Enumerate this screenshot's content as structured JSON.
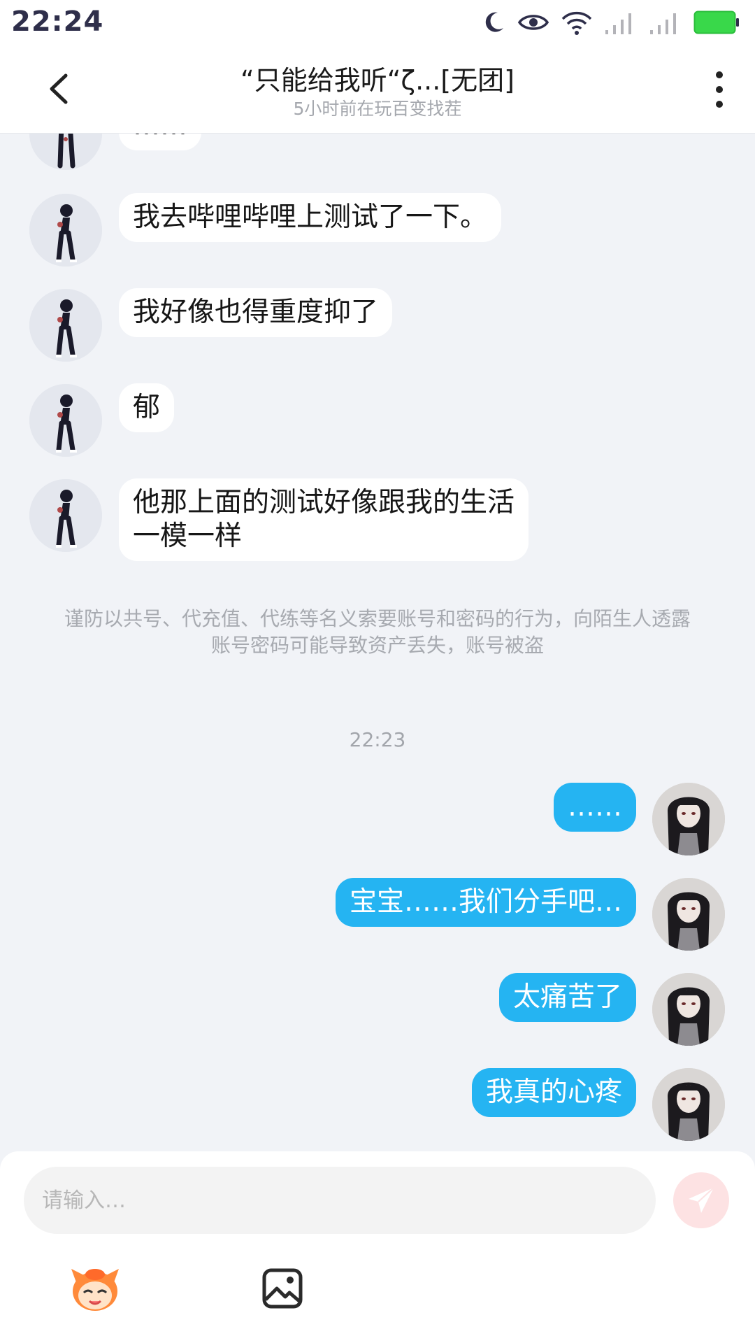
{
  "status": {
    "time": "22:24"
  },
  "header": {
    "title": "“只能给我听“ζ...[无团]",
    "subtitle": "5小时前在玩百变找茬"
  },
  "messages": {
    "partial_top": "……",
    "incoming": [
      "我去哔哩哔哩上测试了一下。",
      "我好像也得重度抑了",
      "郁",
      "他那上面的测试好像跟我的生活\n一模一样"
    ],
    "notice": "谨防以共号、代充值、代练等名义索要账号和密码的行为，向陌生人透露账号密码可能导致资产丢失，账号被盗",
    "timestamp": "22:23",
    "outgoing": [
      "……",
      "宝宝……我们分手吧…",
      "太痛苦了",
      "我真的心疼"
    ]
  },
  "input": {
    "placeholder": "请输入…"
  },
  "colors": {
    "accent_blue": "#25b4f2",
    "send_pink": "#fde2e3",
    "background": "#f1f3f7"
  }
}
